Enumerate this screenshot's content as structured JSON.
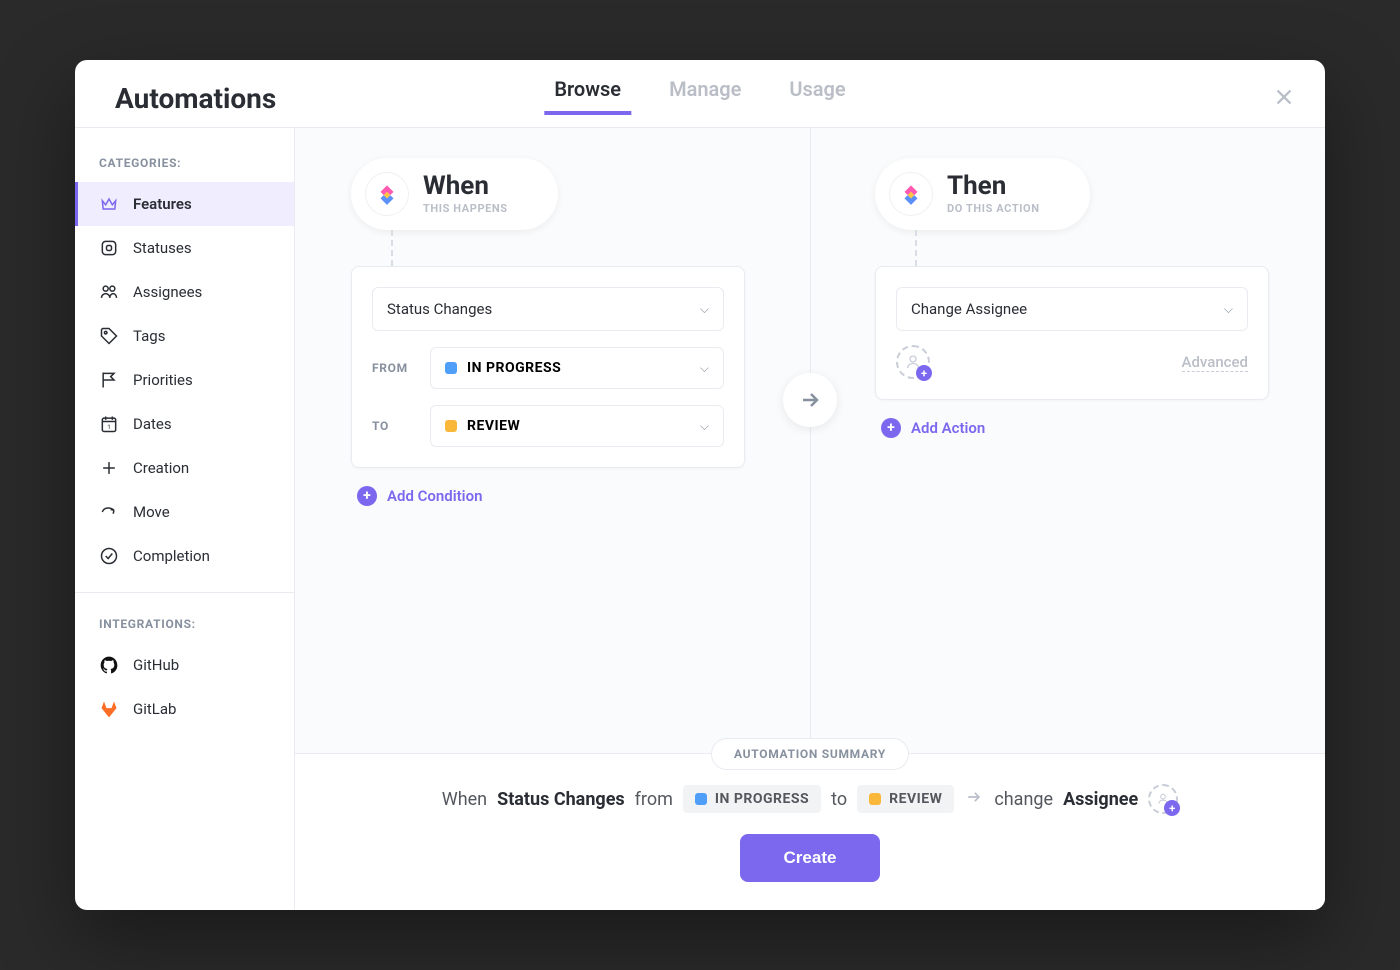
{
  "header": {
    "title": "Automations",
    "tabs": [
      {
        "label": "Browse",
        "active": true
      },
      {
        "label": "Manage",
        "active": false
      },
      {
        "label": "Usage",
        "active": false
      }
    ]
  },
  "sidebar": {
    "categories_heading": "CATEGORIES:",
    "integrations_heading": "INTEGRATIONS:",
    "items": [
      {
        "label": "Features"
      },
      {
        "label": "Statuses"
      },
      {
        "label": "Assignees"
      },
      {
        "label": "Tags"
      },
      {
        "label": "Priorities"
      },
      {
        "label": "Dates"
      },
      {
        "label": "Creation"
      },
      {
        "label": "Move"
      },
      {
        "label": "Completion"
      }
    ],
    "integrations": [
      {
        "label": "GitHub"
      },
      {
        "label": "GitLab"
      }
    ]
  },
  "when": {
    "title": "When",
    "subtitle": "THIS HAPPENS",
    "trigger": "Status Changes",
    "from_label": "FROM",
    "to_label": "TO",
    "from_status": {
      "label": "IN PROGRESS",
      "color": "#4f9ff8"
    },
    "to_status": {
      "label": "REVIEW",
      "color": "#f9b83a"
    },
    "add_condition": "Add Condition"
  },
  "then": {
    "title": "Then",
    "subtitle": "DO THIS ACTION",
    "action": "Change Assignee",
    "advanced": "Advanced",
    "add_action": "Add Action"
  },
  "summary": {
    "badge": "AUTOMATION SUMMARY",
    "when_word": "When",
    "trigger": "Status Changes",
    "from_word": "from",
    "from_status": {
      "label": "IN PROGRESS",
      "color": "#4f9ff8"
    },
    "to_word": "to",
    "to_status": {
      "label": "REVIEW",
      "color": "#f9b83a"
    },
    "change_word": "change",
    "target": "Assignee",
    "create_button": "Create"
  }
}
